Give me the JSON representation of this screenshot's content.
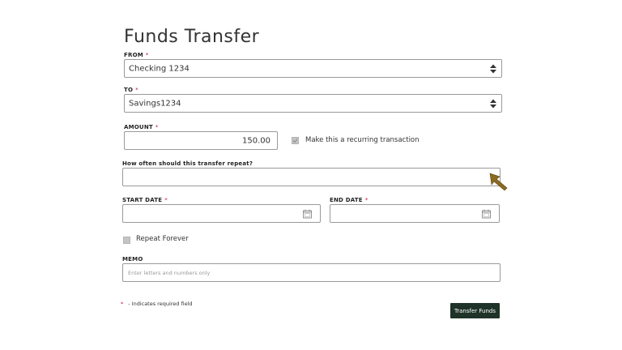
{
  "page": {
    "title": "Funds Transfer"
  },
  "form": {
    "from": {
      "label": "FROM",
      "value": "Checking 1234"
    },
    "to": {
      "label": "TO",
      "value": "Savings1234"
    },
    "amount": {
      "label": "AMOUNT",
      "value": "150.00"
    },
    "recurring": {
      "label": "Make this a recurring transaction",
      "checked": true
    },
    "frequency": {
      "label": "How often should this transfer repeat?",
      "value": ""
    },
    "start_date": {
      "label": "START DATE",
      "value": ""
    },
    "end_date": {
      "label": "END DATE",
      "value": ""
    },
    "repeat_forever": {
      "label": "Repeat Forever",
      "checked": false
    },
    "memo": {
      "label": "MEMO",
      "placeholder": "Enter letters and numbers only"
    },
    "required_star": "*",
    "footnote": "- Indicates required field",
    "submit_label": "Transfer Funds"
  },
  "colors": {
    "required": "#c8102e",
    "button_bg": "#1f3328",
    "cursor": "#8b6a22"
  }
}
